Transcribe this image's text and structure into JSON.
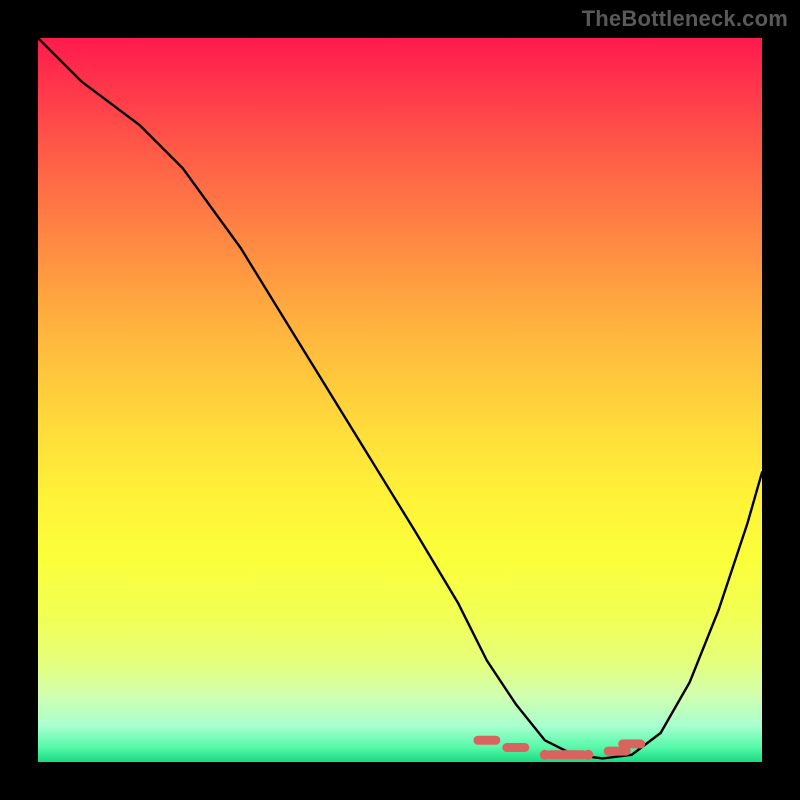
{
  "watermark": "TheBottleneck.com",
  "colors": {
    "page_bg": "#000000",
    "curve": "#000000",
    "marker": "#d9645f",
    "gradient_top": "#ff1a4d",
    "gradient_bottom": "#18db82"
  },
  "chart_data": {
    "type": "line",
    "title": "",
    "xlabel": "",
    "ylabel": "",
    "xlim": [
      0,
      100
    ],
    "ylim": [
      0,
      100
    ],
    "x": [
      0,
      2,
      6,
      10,
      14,
      20,
      28,
      36,
      44,
      52,
      58,
      62,
      66,
      70,
      74,
      78,
      82,
      86,
      90,
      94,
      98,
      100
    ],
    "values": [
      100,
      98,
      94,
      91,
      88,
      82,
      71,
      58,
      45,
      32,
      22,
      14,
      8,
      3,
      1,
      0.5,
      1,
      4,
      11,
      21,
      33,
      40
    ],
    "markers_x": [
      62,
      66,
      70,
      72,
      74,
      76,
      80,
      82
    ],
    "markers_y": [
      3,
      2,
      1,
      1,
      1,
      1,
      1.5,
      2.5
    ],
    "notes": "Single black curve over red-to-green vertical gradient; small reddish markers clustered near the curve minimum (~x≈74). Axis values estimated on 0–100 scale; y represents distance from bottom (bottleneck % style)."
  }
}
